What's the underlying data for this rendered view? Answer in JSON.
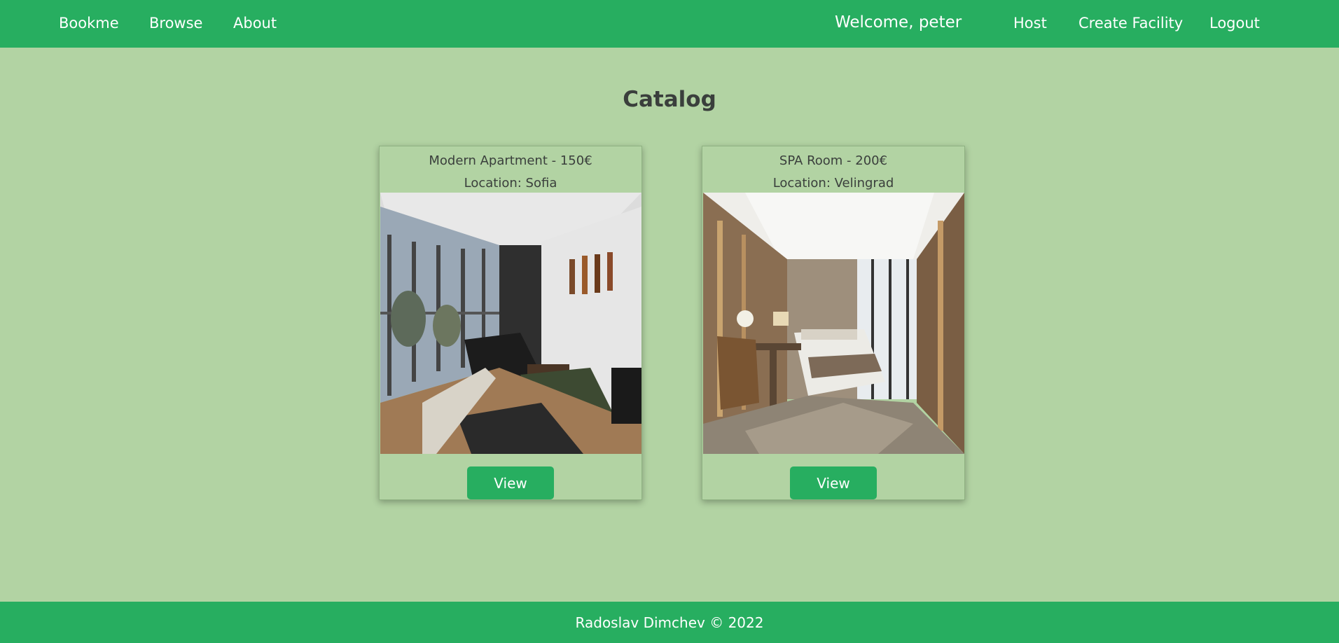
{
  "nav": {
    "brand": "Bookme",
    "browse": "Browse",
    "about": "About",
    "welcome": "Welcome, peter",
    "host": "Host",
    "create_facility": "Create Facility",
    "logout": "Logout"
  },
  "main": {
    "title": "Catalog",
    "cards": [
      {
        "title": "Modern Apartment - 150€",
        "location": "Location: Sofia",
        "view_label": "View",
        "image_icon": "apartment-living-room-photo"
      },
      {
        "title": "SPA Room - 200€",
        "location": "Location: Velingrad",
        "view_label": "View",
        "image_icon": "hotel-bedroom-photo"
      }
    ]
  },
  "footer": {
    "text": "Radoslav Dimchev © 2022"
  },
  "colors": {
    "accent": "#27ae60",
    "background": "#b2d3a3",
    "text": "#3a3f3c"
  }
}
